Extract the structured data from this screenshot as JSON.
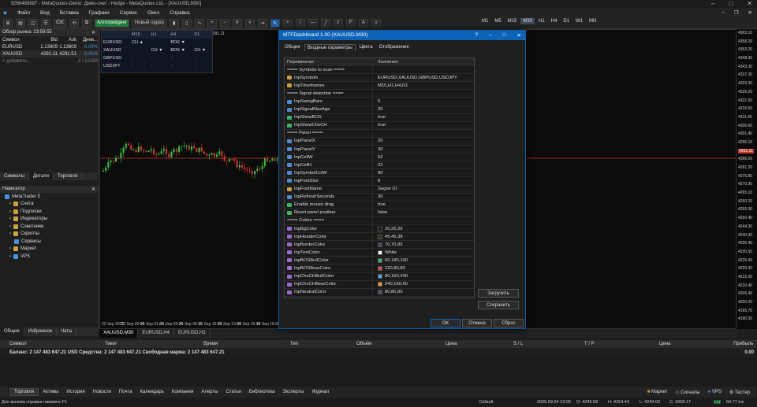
{
  "window": {
    "title": "5056488887 - MetaQuotes-Demo: Демо-счет - Hedge - MetaQuotes Ltd. - [XAUUSD,M30]"
  },
  "menu": [
    "Файл",
    "Вид",
    "Вставка",
    "Графики",
    "Сервис",
    "Окно",
    "Справка"
  ],
  "toolbar": {
    "algo_label": "Алготрейдинг",
    "new_order_label": "Новый ордер",
    "timeframes": [
      "M1",
      "M5",
      "M15",
      "M30",
      "H1",
      "H4",
      "D1",
      "W1",
      "MN"
    ],
    "selected_tf": "M30"
  },
  "market_watch": {
    "title": "Обзор рынка: 23:59:55",
    "headers": [
      "Символ",
      "Bid",
      "Ask",
      "Днев..."
    ],
    "rows": [
      {
        "symbol": "EURUSD",
        "bid": "1.13609",
        "ask": "1.13609",
        "change": "0.09%"
      },
      {
        "symbol": "XAUUSD",
        "bid": "4291.11",
        "ask": "4291.51",
        "change": "0.41%"
      }
    ],
    "add_label": "+ добавить...",
    "count": "2 / 12383",
    "tabs": [
      "Символы",
      "Детали",
      "Торговля"
    ]
  },
  "navigator": {
    "title": "Навигатор",
    "root": "MetaTrader 5",
    "items": [
      "Счета",
      "Подписки",
      "Индикаторы",
      "Советники",
      "Скрипты",
      "Сервисы",
      "Маркет",
      "VPS"
    ]
  },
  "left_bottom_tabs": [
    "Общие",
    "Избранное",
    "Чаты"
  ],
  "dashboard": {
    "headers": [
      "",
      "M15",
      "H1",
      "H4",
      "D1"
    ],
    "rows": [
      {
        "sym": "EURUSD",
        "cells": [
          [
            "CH ▲",
            "bb"
          ],
          [
            "",
            ""
          ],
          [
            "BOS ▼",
            "br"
          ],
          [
            "",
            ""
          ]
        ]
      },
      {
        "sym": "XAUUSD",
        "cells": [
          [
            "",
            ""
          ],
          [
            "CH ▼",
            "br"
          ],
          [
            "BOS ▼",
            "br"
          ],
          [
            "CH ▼",
            "br"
          ]
        ]
      },
      {
        "sym": "GBPUSD",
        "cells": [
          [
            "",
            ""
          ],
          [
            "",
            ""
          ],
          [
            "",
            ""
          ],
          [
            "",
            ""
          ]
        ]
      },
      {
        "sym": "USDJPY",
        "cells": [
          [
            "",
            ""
          ],
          [
            "",
            ""
          ],
          [
            "",
            ""
          ],
          [
            "",
            ""
          ]
        ]
      }
    ]
  },
  "chart": {
    "symbol_label": "XAUUSD,M30",
    "corner_price": "4291.11",
    "price_labels": [
      "4363.10",
      "4358.20",
      "4353.20",
      "4348.30",
      "4343.30",
      "4337.30",
      "4333.30",
      "4326.20",
      "4321.50",
      "4316.50",
      "4311.40",
      "4306.60",
      "4301.40",
      "4296.10",
      "4291.11",
      "4286.50",
      "4281.20",
      "4275.80",
      "4270.30",
      "4265.10",
      "4260.20",
      "4255.30",
      "4250.40",
      "4244.30",
      "4240.30",
      "4235.40",
      "4230.50",
      "4225.40",
      "4220.30",
      "4215.30",
      "4210.40",
      "4205.40",
      "4200.20",
      "4195.70",
      "4190.30"
    ],
    "time_labels": [
      "23 Sep 2025",
      "23 Sep 20:00",
      "24 Sep 01:00",
      "24 Sep 03:30",
      "24 Sep 06:30",
      "24 Sep 10:30",
      "24 Sep 13:00",
      "24 Sep 15:30",
      "24 Sep 18:00",
      "24 Sep 20:30"
    ],
    "tabs": [
      "XAUUSD,M30",
      "EURUSD,H4",
      "EURUSD,H1"
    ]
  },
  "dialog": {
    "title": "MTFDashboard 1.00 (XAUUSD,M30)",
    "tabs": [
      "Общие",
      "Входные параметры",
      "Цвета",
      "Отображение"
    ],
    "active_tab": "Входные параметры",
    "col_name": "Переменная",
    "col_value": "Значение",
    "rows": [
      {
        "name": "==== Symbols to scan ====",
        "value": "",
        "type": "sec"
      },
      {
        "name": "InpSymbols",
        "value": "EURUSD,XAUUSD,GBPUSD,USDJPY",
        "type": "str"
      },
      {
        "name": "InpTimeframes",
        "value": "M15,H1,H4,D1",
        "type": "str"
      },
      {
        "name": "==== Signal detection ====",
        "value": "",
        "type": "sec"
      },
      {
        "name": "InpSwingBars",
        "value": "5",
        "type": "num"
      },
      {
        "name": "InpSignalMaxAge",
        "value": "20",
        "type": "num"
      },
      {
        "name": "InpShowBOS",
        "value": "true",
        "type": "bool"
      },
      {
        "name": "InpShowChoCH",
        "value": "true",
        "type": "bool"
      },
      {
        "name": "==== Panel ====",
        "value": "",
        "type": "sec"
      },
      {
        "name": "InpPanelX",
        "value": "20",
        "type": "num"
      },
      {
        "name": "InpPanelY",
        "value": "30",
        "type": "num"
      },
      {
        "name": "InpCellW",
        "value": "52",
        "type": "num"
      },
      {
        "name": "InpCellH",
        "value": "22",
        "type": "num"
      },
      {
        "name": "InpSymbolColW",
        "value": "80",
        "type": "num"
      },
      {
        "name": "InpFontSize",
        "value": "8",
        "type": "num"
      },
      {
        "name": "InpFontName",
        "value": "Segoe UI",
        "type": "str"
      },
      {
        "name": "InpRefreshSeconds",
        "value": "30",
        "type": "num"
      },
      {
        "name": "Enable mouse drag",
        "value": "true",
        "type": "bool"
      },
      {
        "name": "Reset panel position",
        "value": "false",
        "type": "bool"
      },
      {
        "name": "==== Colors ====",
        "value": "",
        "type": "sec"
      },
      {
        "name": "InpBgColor",
        "value": "20,20,26",
        "type": "color",
        "color": "#14141a"
      },
      {
        "name": "InpHeaderColor",
        "value": "45,45,38",
        "type": "color",
        "color": "#2d2d26"
      },
      {
        "name": "InpBorderColor",
        "value": "70,70,85",
        "type": "color",
        "color": "#464655"
      },
      {
        "name": "InpTextColor",
        "value": "White",
        "type": "color",
        "color": "#ffffff"
      },
      {
        "name": "InpBOSBullColor",
        "value": "60,180,100",
        "type": "color",
        "color": "#3cb464"
      },
      {
        "name": "InpBOSBearColor",
        "value": "220,80,80",
        "type": "color",
        "color": "#dc5050"
      },
      {
        "name": "InpChoCHBullColor",
        "value": "80,160,240",
        "type": "color",
        "color": "#50a0f0"
      },
      {
        "name": "InpChoCHBearColor",
        "value": "240,160,60",
        "type": "color",
        "color": "#f0a03c"
      },
      {
        "name": "InpNeutralColor",
        "value": "80,80,90",
        "type": "color",
        "color": "#50505a"
      }
    ],
    "load_label": "Загрузить",
    "save_label": "Сохранить",
    "ok_label": "OK",
    "cancel_label": "Отмена",
    "reset_label": "Сброс"
  },
  "trade": {
    "headers": [
      "Символ",
      "Тикет",
      "Время",
      "Тип",
      "Объём",
      "Цена",
      "S / L",
      "T / P",
      "Цена",
      "Прибыль"
    ],
    "balance": "Баланс: 2 147 483 647.21 USD  Средства: 2 147 483 647.21  Свободная маржа: 2 147 483 647.21",
    "profit": "0.00",
    "toolbox_label": "Инструменты"
  },
  "bottom_tabs": [
    "Торговля",
    "Активы",
    "История",
    "Новости",
    "Почта",
    "Календарь",
    "Компания",
    "Алерты",
    "Статьи",
    "Библиотека",
    "Эксперты",
    "Журнал"
  ],
  "bottom_right": [
    "Маркет",
    "Сигналы",
    "VPS",
    "Тестер"
  ],
  "status": {
    "help": "Для вызова справки нажмите F1",
    "profile": "Default",
    "datetime": "2026.09.24 13:00",
    "open": "O: 4245.58",
    "high": "H: 4264.43",
    "low": "L: 4244.03",
    "close": "C: 4258.17",
    "ping": "84.77 ms"
  }
}
